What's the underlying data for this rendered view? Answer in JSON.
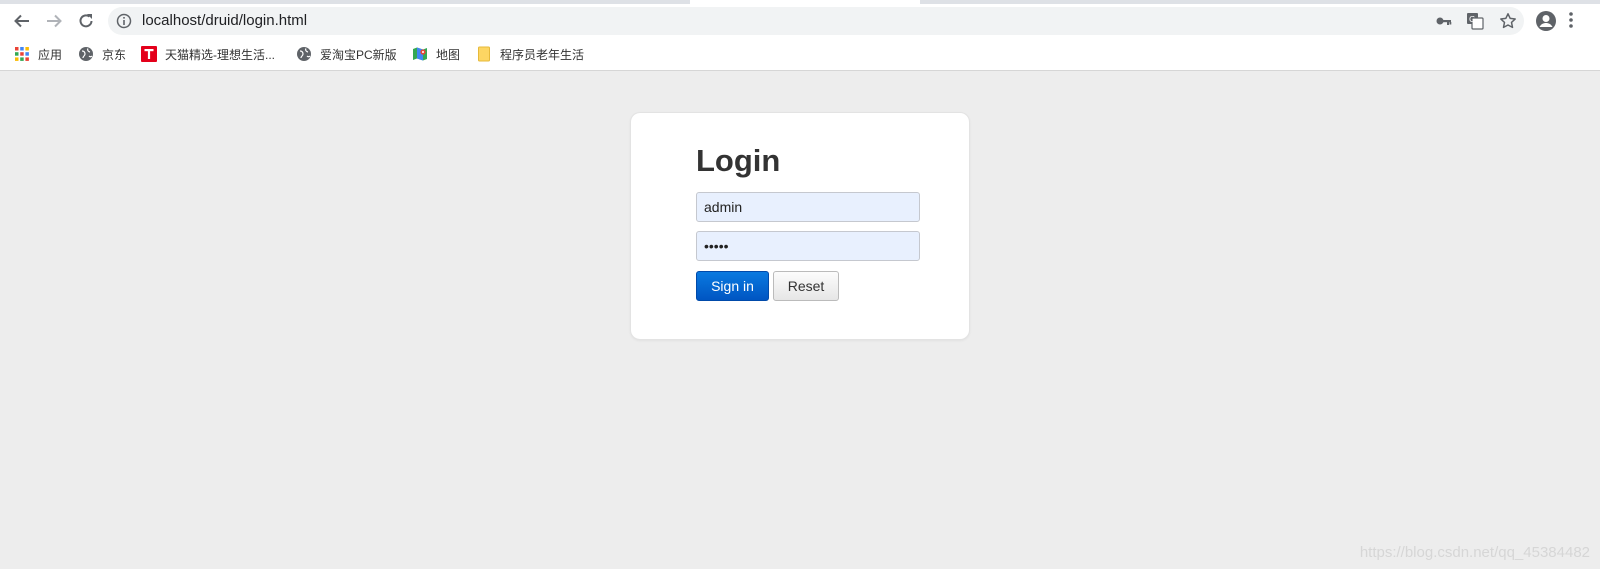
{
  "browser": {
    "url": "localhost/druid/login.html",
    "bookmarks": [
      {
        "label": "应用",
        "icon": "apps-grid-icon"
      },
      {
        "label": "京东",
        "icon": "globe-icon"
      },
      {
        "label": "天猫精选-理想生活...",
        "icon": "tmall-icon"
      },
      {
        "label": "爱淘宝PC新版",
        "icon": "globe-icon"
      },
      {
        "label": "地图",
        "icon": "maps-icon"
      },
      {
        "label": "程序员老年生活",
        "icon": "folder-icon"
      }
    ]
  },
  "login": {
    "title": "Login",
    "username_value": "admin",
    "password_value": "admin",
    "sign_in_label": "Sign in",
    "reset_label": "Reset"
  },
  "watermark": "https://blog.csdn.net/qq_45384482",
  "colors": {
    "page_bg": "#ededed",
    "primary_button": "#0066cc",
    "input_autofill": "#e8f0fe"
  }
}
